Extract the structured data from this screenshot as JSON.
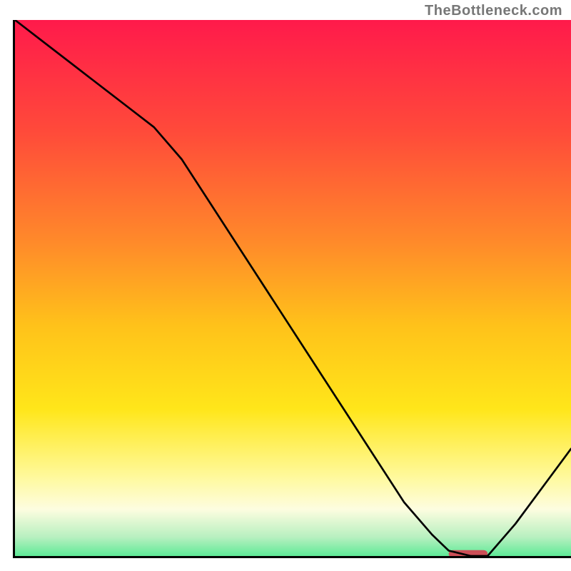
{
  "watermark": "TheBottleneck.com",
  "chart_data": {
    "type": "line",
    "title": "",
    "xlabel": "",
    "ylabel": "",
    "xlim": [
      0,
      100
    ],
    "ylim": [
      0,
      100
    ],
    "x": [
      0,
      5,
      10,
      15,
      20,
      25,
      30,
      35,
      40,
      45,
      50,
      55,
      60,
      65,
      70,
      75,
      78,
      82,
      85,
      90,
      95,
      100
    ],
    "values": [
      100,
      96,
      92,
      88,
      84,
      80,
      74,
      66,
      58,
      50,
      42,
      34,
      26,
      18,
      10,
      4,
      1,
      0,
      0,
      6,
      13,
      20
    ],
    "marker": {
      "x_start": 78,
      "x_end": 85,
      "y": 0,
      "color": "#cc4f57",
      "shape": "rounded-bar"
    },
    "background_gradient": {
      "stops": [
        {
          "pos": 0.0,
          "color": "#ff1a4b"
        },
        {
          "pos": 0.2,
          "color": "#ff4a3a"
        },
        {
          "pos": 0.4,
          "color": "#ff8a2a"
        },
        {
          "pos": 0.55,
          "color": "#ffc21a"
        },
        {
          "pos": 0.7,
          "color": "#ffe61a"
        },
        {
          "pos": 0.82,
          "color": "#fff99a"
        },
        {
          "pos": 0.88,
          "color": "#fdfde0"
        },
        {
          "pos": 0.93,
          "color": "#b8f0c0"
        },
        {
          "pos": 0.97,
          "color": "#4fe890"
        },
        {
          "pos": 1.0,
          "color": "#00d870"
        }
      ]
    }
  }
}
